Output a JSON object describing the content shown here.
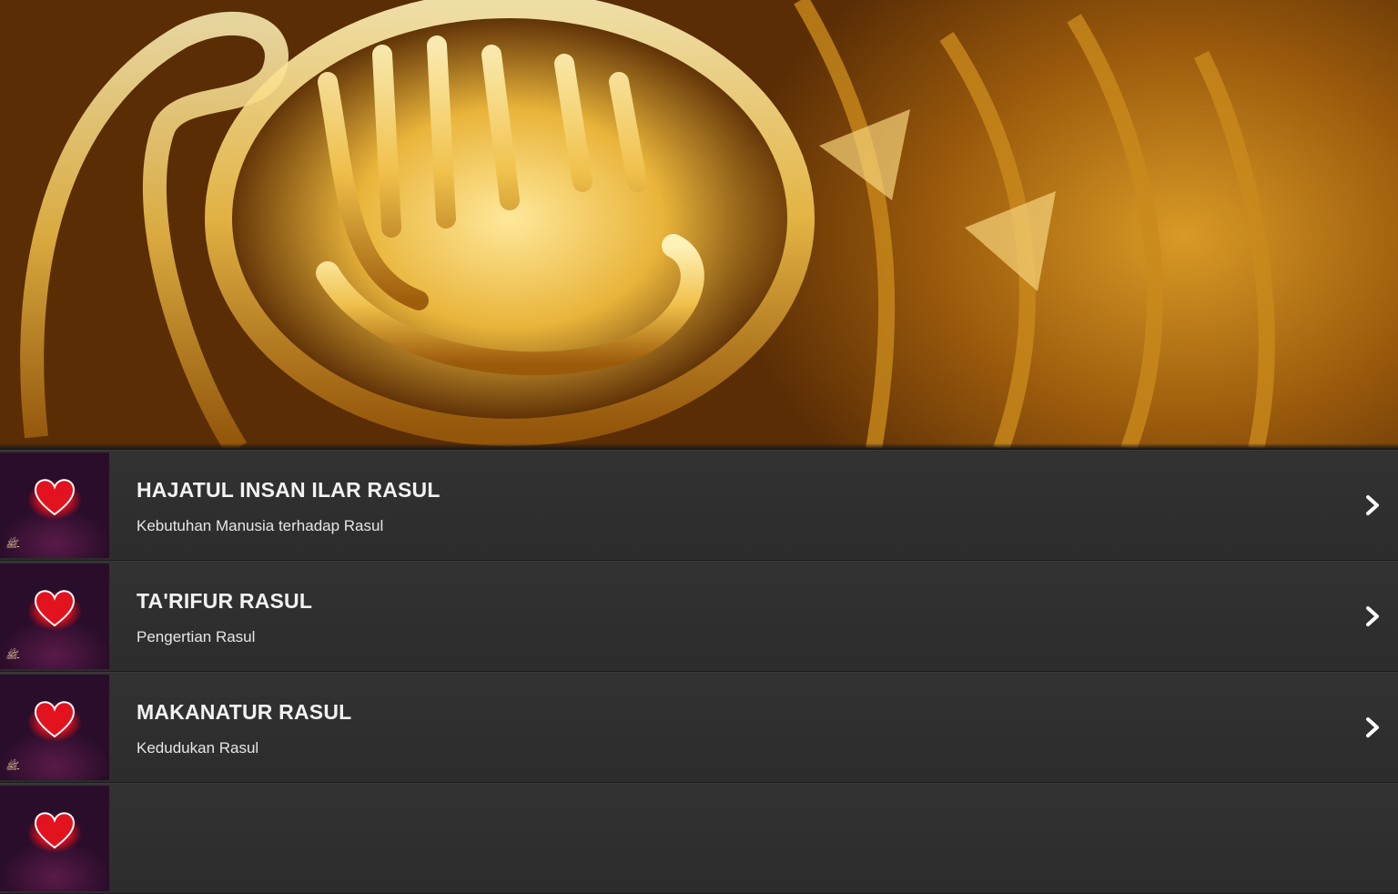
{
  "banner": {
    "image_desc": "gold-calligraphy-banner"
  },
  "list": {
    "items": [
      {
        "title": "HAJATUL INSAN ILAR RASUL",
        "subtitle": "Kebutuhan Manusia terhadap Rasul"
      },
      {
        "title": "TA'RIFUR RASUL",
        "subtitle": "Pengertian Rasul"
      },
      {
        "title": "MAKANATUR RASUL",
        "subtitle": "Kedudukan Rasul"
      },
      {
        "title": "",
        "subtitle": ""
      }
    ]
  },
  "icons": {
    "thumbnail": "heart-thumbnail-icon",
    "row_arrow": "chevron-right-icon"
  },
  "colors": {
    "list_background": "#2b2b2b",
    "text": "#f2f2f2",
    "banner_gold": "#e9b43a"
  }
}
